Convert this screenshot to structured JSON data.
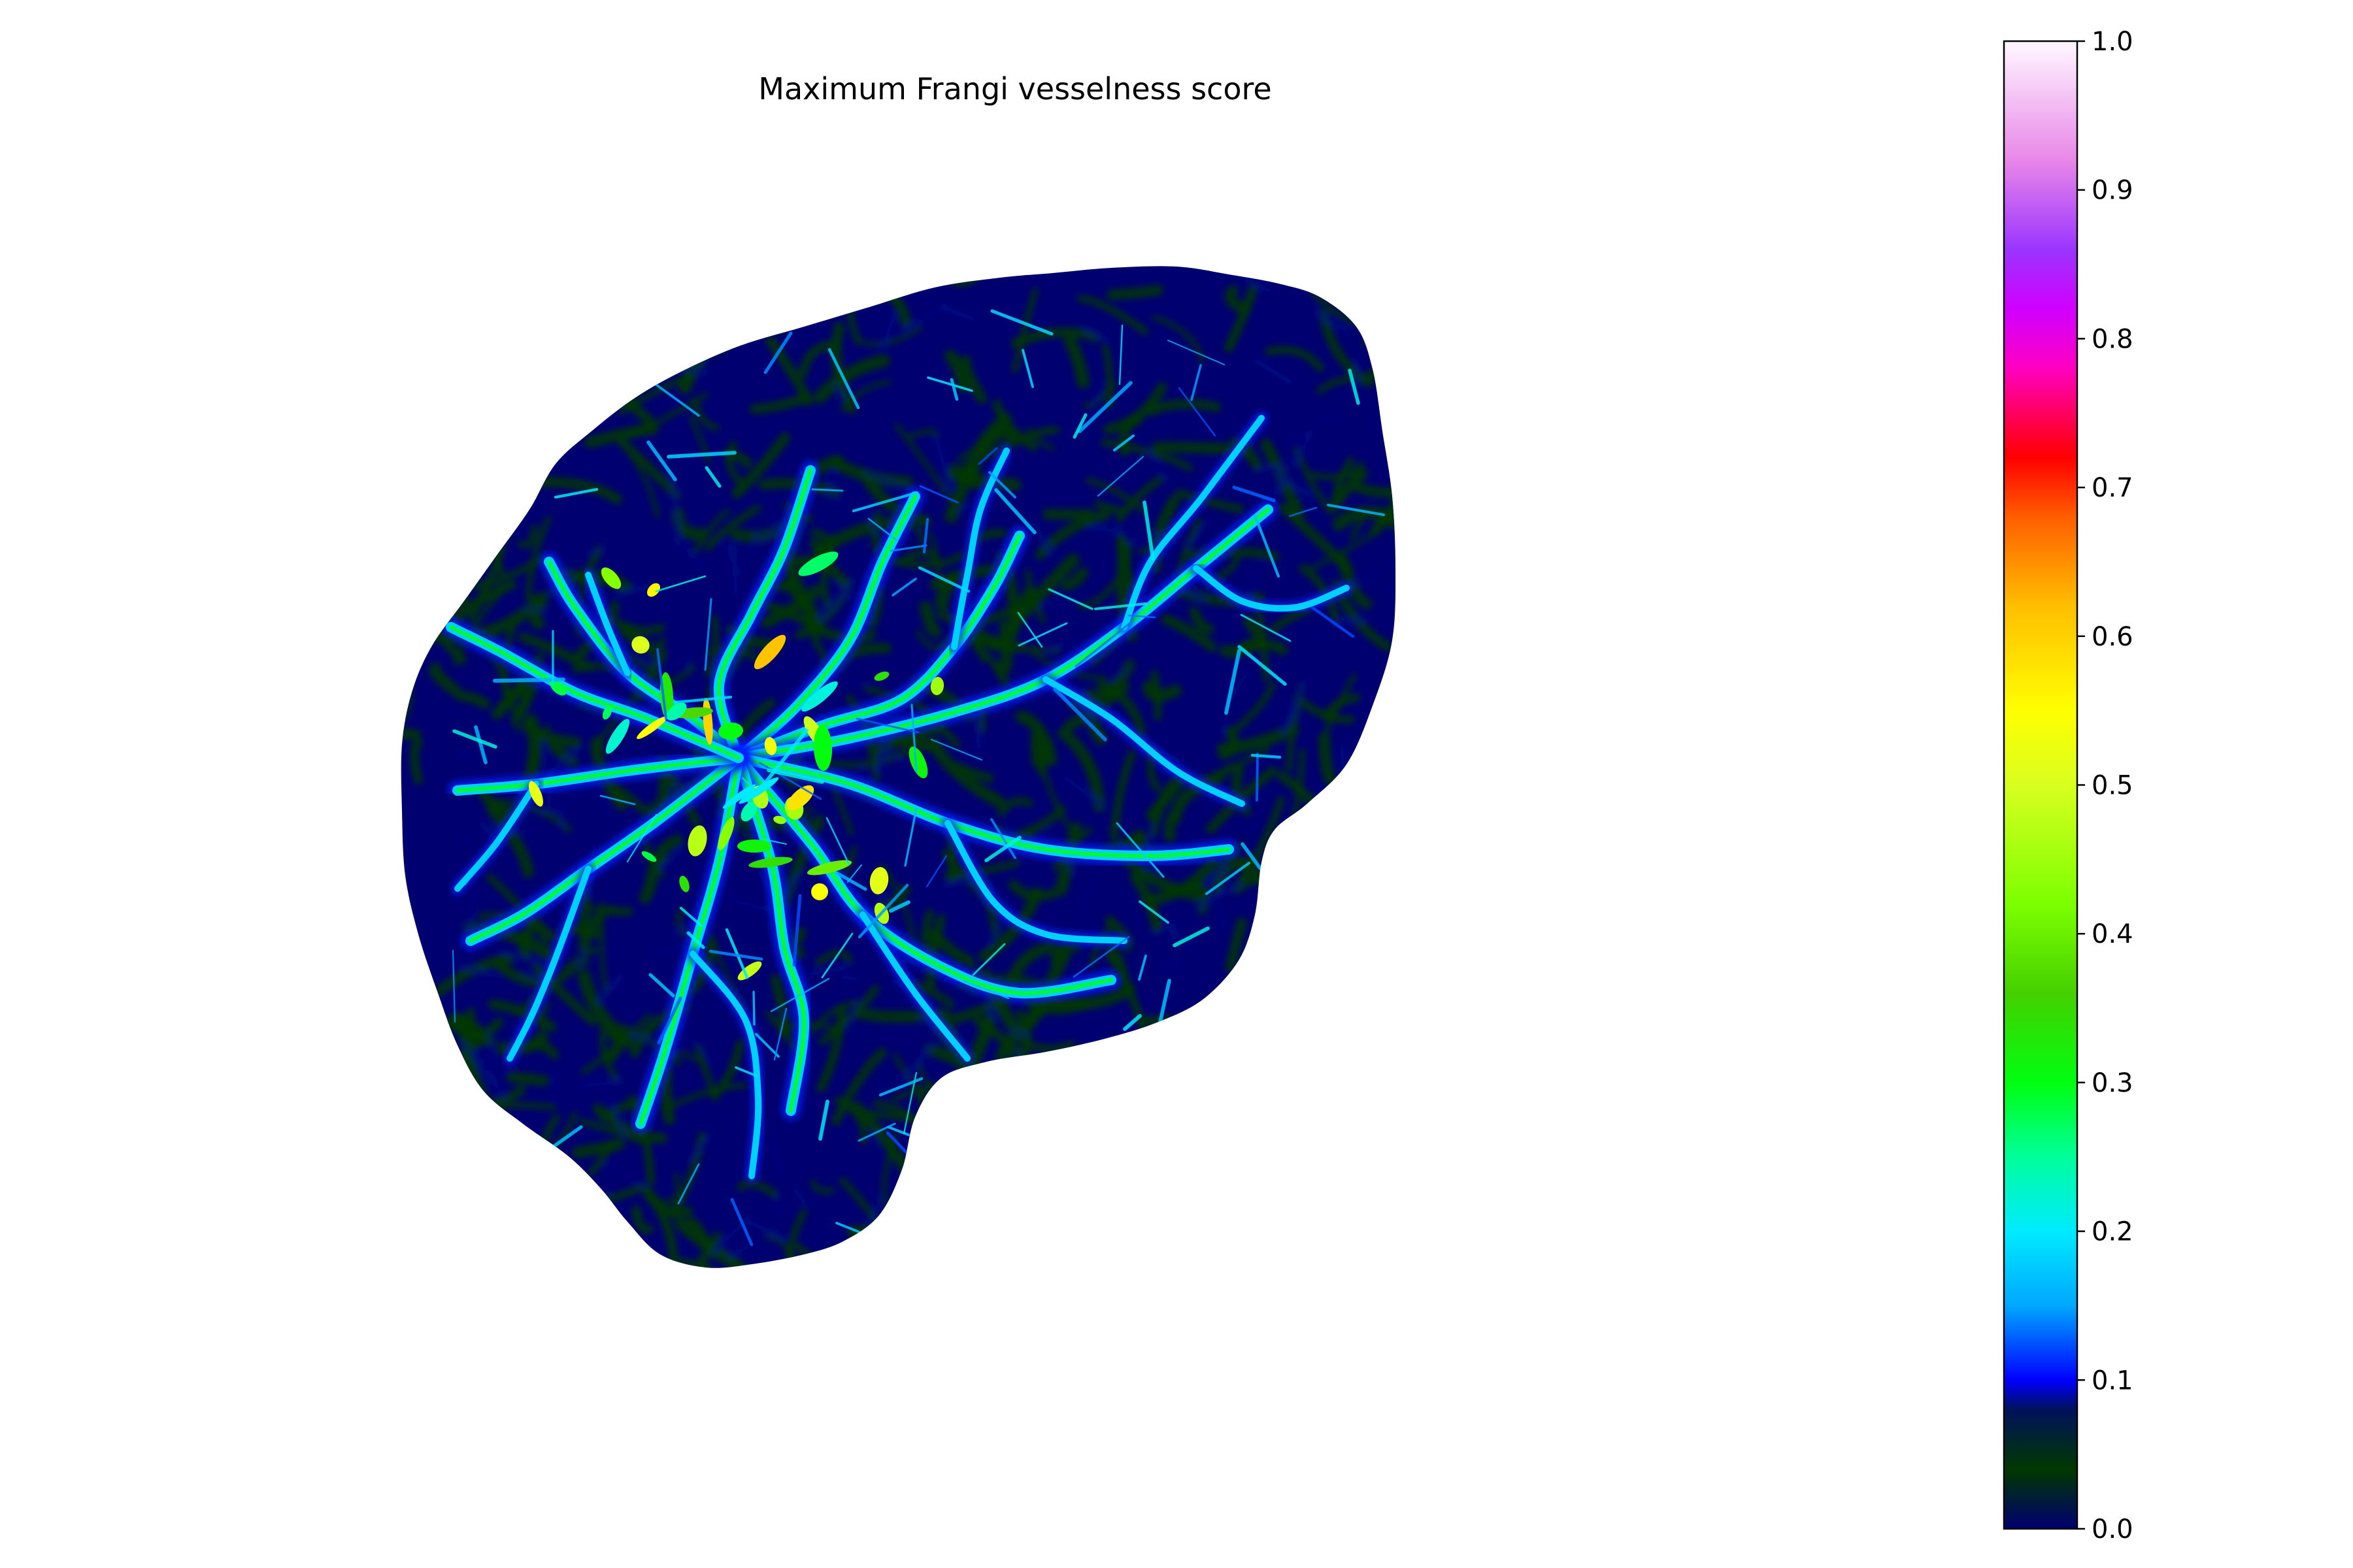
{
  "chart_data": {
    "type": "heatmap",
    "title": "Maximum Frangi vesselness score",
    "xlabel": "",
    "ylabel": "",
    "axes_visible": false,
    "background": "#ffffff",
    "mask_shape": "irregular blob (vessel network image)",
    "colormap": {
      "name": "gist_ncar-like",
      "range": [
        0,
        1
      ],
      "stops": [
        {
          "v": 0.0,
          "color": "#000070"
        },
        {
          "v": 0.04,
          "color": "#003800"
        },
        {
          "v": 0.08,
          "color": "#00125a"
        },
        {
          "v": 0.1,
          "color": "#0000ff"
        },
        {
          "v": 0.15,
          "color": "#00a8ff"
        },
        {
          "v": 0.2,
          "color": "#00eaff"
        },
        {
          "v": 0.25,
          "color": "#00ff9a"
        },
        {
          "v": 0.3,
          "color": "#00ff10"
        },
        {
          "v": 0.36,
          "color": "#45d000"
        },
        {
          "v": 0.42,
          "color": "#7cff00"
        },
        {
          "v": 0.5,
          "color": "#d8ff20"
        },
        {
          "v": 0.55,
          "color": "#ffff00"
        },
        {
          "v": 0.62,
          "color": "#ffbf00"
        },
        {
          "v": 0.68,
          "color": "#ff5e00"
        },
        {
          "v": 0.72,
          "color": "#ff0000"
        },
        {
          "v": 0.78,
          "color": "#ff00c0"
        },
        {
          "v": 0.82,
          "color": "#d000ff"
        },
        {
          "v": 0.86,
          "color": "#9b35ff"
        },
        {
          "v": 0.92,
          "color": "#e887e8"
        },
        {
          "v": 1.0,
          "color": "#fff8ff"
        }
      ]
    },
    "colorbar": {
      "orientation": "vertical",
      "placement": "right",
      "ticks": [
        "0.0",
        "0.1",
        "0.2",
        "0.3",
        "0.4",
        "0.5",
        "0.6",
        "0.7",
        "0.8",
        "0.9",
        "1.0"
      ],
      "tick_values": [
        0,
        0.1,
        0.2,
        0.3,
        0.4,
        0.5,
        0.6,
        0.7,
        0.8,
        0.9,
        1.0
      ]
    },
    "value_summary": {
      "background_level": 0.0,
      "texture_level": 0.04,
      "minor_vessel_level": 0.18,
      "major_vessel_level": 0.5,
      "peak_level": 0.62
    }
  }
}
